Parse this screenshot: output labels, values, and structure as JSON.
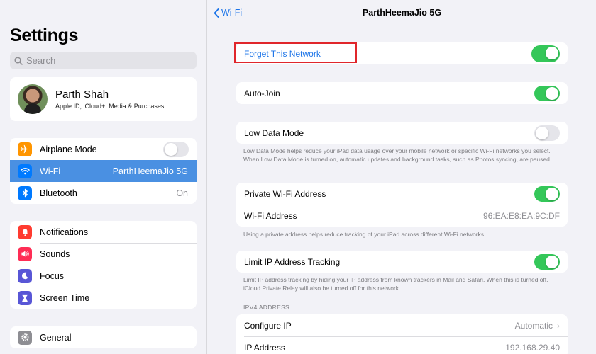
{
  "sidebar": {
    "title": "Settings",
    "search_placeholder": "Search",
    "profile": {
      "name": "Parth Shah",
      "subtitle": "Apple ID, iCloud+, Media & Purchases"
    },
    "group1": [
      {
        "label": "Airplane Mode",
        "icon": "airplane-icon",
        "color": "#ff9500",
        "toggle": "off"
      },
      {
        "label": "Wi-Fi",
        "icon": "wifi-icon",
        "color": "#007aff",
        "value": "ParthHeemaJio 5G",
        "selected": true
      },
      {
        "label": "Bluetooth",
        "icon": "bluetooth-icon",
        "color": "#007aff",
        "value": "On"
      }
    ],
    "group2": [
      {
        "label": "Notifications",
        "icon": "bell-icon",
        "color": "#ff3b30"
      },
      {
        "label": "Sounds",
        "icon": "speaker-icon",
        "color": "#ff2d55"
      },
      {
        "label": "Focus",
        "icon": "moon-icon",
        "color": "#5856d6"
      },
      {
        "label": "Screen Time",
        "icon": "hourglass-icon",
        "color": "#5856d6"
      }
    ],
    "group3": [
      {
        "label": "General",
        "icon": "gear-icon",
        "color": "#8e8e93"
      }
    ]
  },
  "main": {
    "back_label": "Wi-Fi",
    "title": "ParthHeemaJio 5G",
    "forget_label": "Forget This Network",
    "auto_join": {
      "label": "Auto-Join",
      "toggle": "on"
    },
    "low_data": {
      "label": "Low Data Mode",
      "toggle": "off",
      "note": "Low Data Mode helps reduce your iPad data usage over your mobile network or specific Wi-Fi networks you select. When Low Data Mode is turned on, automatic updates and background tasks, such as Photos syncing, are paused."
    },
    "private_addr": {
      "label": "Private Wi-Fi Address",
      "toggle": "on",
      "wifi_address_label": "Wi-Fi Address",
      "wifi_address_value": "96:EA:E8:EA:9C:DF",
      "note": "Using a private address helps reduce tracking of your iPad across different Wi-Fi networks."
    },
    "limit_ip": {
      "label": "Limit IP Address Tracking",
      "toggle": "on",
      "note": "Limit IP address tracking by hiding your IP address from known trackers in Mail and Safari. When this is turned off, iCloud Private Relay will also be turned off for this network."
    },
    "ipv4": {
      "header": "IPV4 ADDRESS",
      "configure_label": "Configure IP",
      "configure_value": "Automatic",
      "ip_label": "IP Address",
      "ip_value": "192.168.29.40"
    }
  }
}
